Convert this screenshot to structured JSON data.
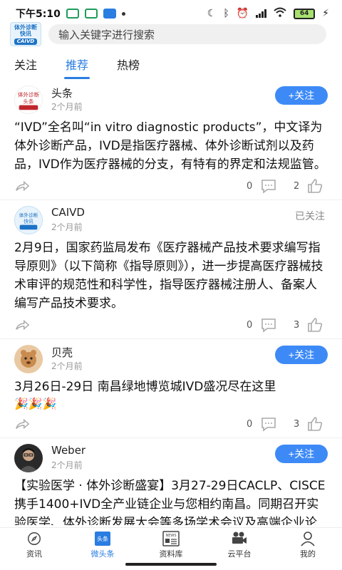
{
  "status_bar": {
    "time": "下午5:10",
    "battery": "64"
  },
  "logo": {
    "line1": "体外诊断",
    "line2": "快讯",
    "line3": "CAIVD"
  },
  "search": {
    "placeholder": "输入关键字进行搜索"
  },
  "tabs": [
    {
      "label": "关注",
      "active": false
    },
    {
      "label": "推荐",
      "active": true
    },
    {
      "label": "热榜",
      "active": false
    }
  ],
  "posts": [
    {
      "author": "头条",
      "time": "2个月前",
      "follow_label": "+关注",
      "text": "“IVD”全名叫“in vitro diagnostic products”，中文译为体外诊断产品，IVD是指医疗器械、体外诊断试剂以及药品，IVD作为医疗器械的分支，有特有的界定和法规监管。",
      "comments": "0",
      "likes": "2"
    },
    {
      "author": "CAIVD",
      "time": "2个月前",
      "followed_label": "已关注",
      "text": "2月9日，国家药监局发布《医疗器械产品技术要求编写指导原则》（以下简称《指导原则》），进一步提高医疗器械技术审评的规范性和科学性，指导医疗器械注册人、备案人编写产品技术要求。",
      "comments": "0",
      "likes": "3"
    },
    {
      "author": "贝壳",
      "time": "2个月前",
      "follow_label": "+关注",
      "text": "3月26日-29日 南昌绿地博览城IVD盛况尽在这里",
      "emoji": "🎉🎉🎉",
      "comments": "0",
      "likes": "3"
    },
    {
      "author": "Weber",
      "time": "2个月前",
      "follow_label": "+关注",
      "text": "【实验医学 · 体外诊断盛宴】3月27-29日CACLP、CISCE携手1400+IVD全产业链企业与您相约南昌。同期召开实验医学、体外诊断发展大会等多场学术会议及高端企业论坛，欢迎注册参观😊"
    }
  ],
  "bottom_nav": [
    {
      "label": "资讯",
      "icon": "compass-icon",
      "active": false
    },
    {
      "label": "微头条",
      "icon": "headline-icon",
      "badge": "头条",
      "active": true
    },
    {
      "label": "资料库",
      "icon": "news-icon",
      "badge": "NEWS",
      "active": false
    },
    {
      "label": "云平台",
      "icon": "video-camera-icon",
      "active": false
    },
    {
      "label": "我的",
      "icon": "user-icon",
      "active": false
    }
  ],
  "colors": {
    "accent": "#3d8af7",
    "tab_active": "#2a7de1"
  }
}
